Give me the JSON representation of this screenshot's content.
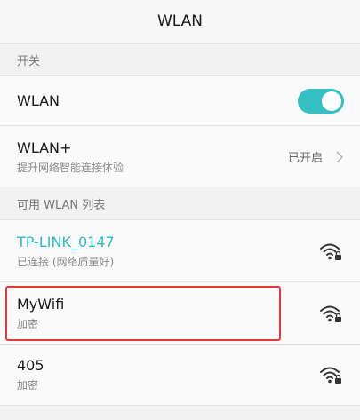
{
  "header": {
    "title": "WLAN"
  },
  "switch_section": {
    "header": "开关",
    "wlan_label": "WLAN",
    "wlan_enabled": true,
    "wlan_plus": {
      "label": "WLAN+",
      "subtitle": "提升网络智能连接体验",
      "status": "已开启"
    }
  },
  "available_section": {
    "header": "可用 WLAN 列表",
    "networks": [
      {
        "name": "TP-LINK_0147",
        "status": "已连接 (网络质量好)",
        "connected": true,
        "icon": "wifi-lock-icon"
      },
      {
        "name": "MyWifi",
        "status": "加密",
        "connected": false,
        "icon": "wifi-lock-icon"
      },
      {
        "name": "405",
        "status": "加密",
        "connected": false,
        "icon": "wifi-lock-icon"
      }
    ]
  },
  "colors": {
    "accent": "#2dbcc1",
    "toggle_on": "#37c0c4",
    "highlight": "#e53935"
  }
}
